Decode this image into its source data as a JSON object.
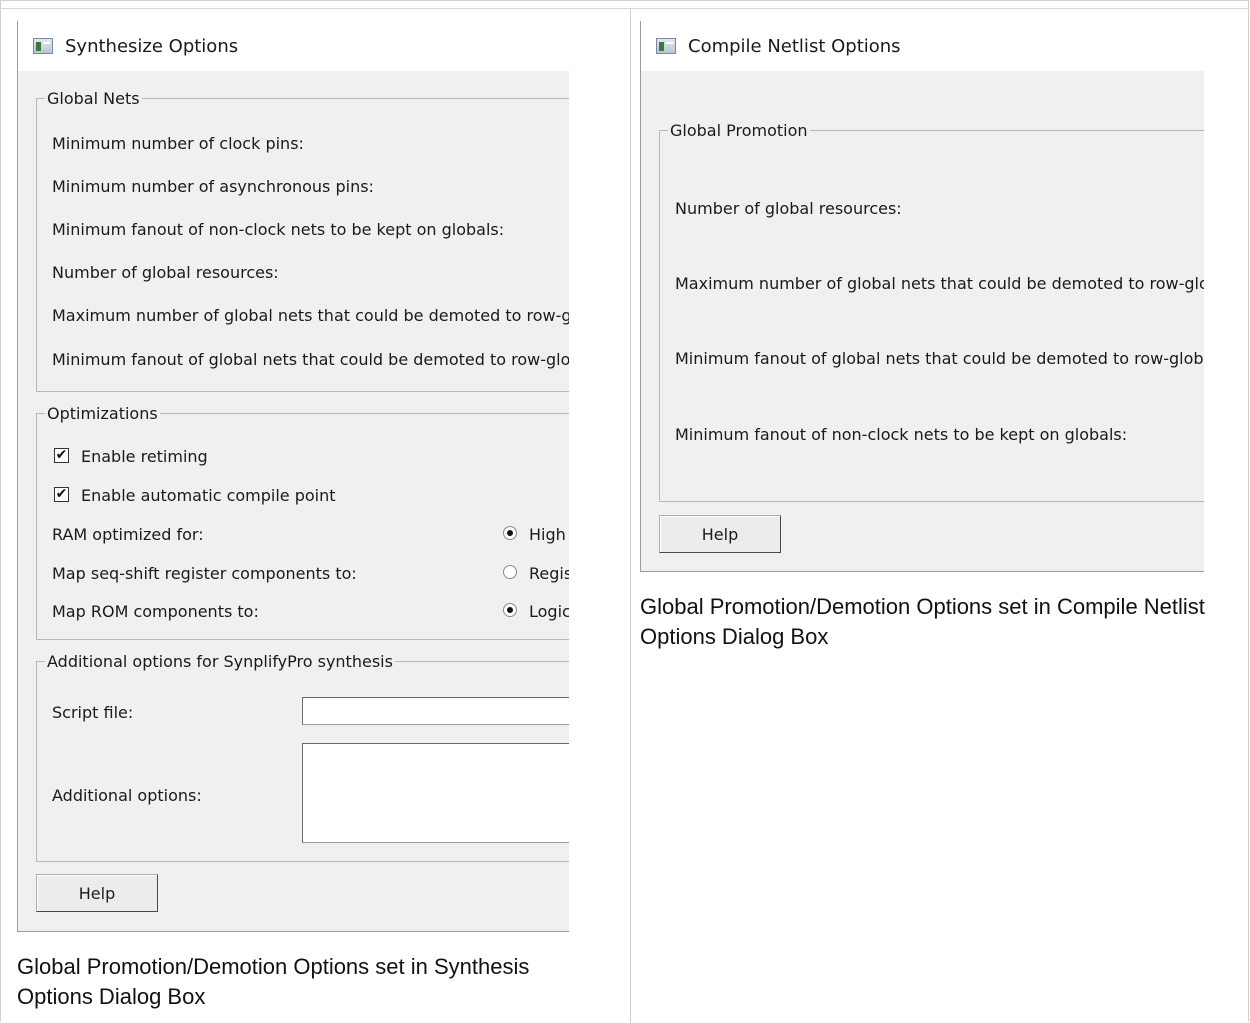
{
  "synth": {
    "title": "Synthesize Options",
    "global_nets": {
      "legend": "Global Nets",
      "rows": [
        "Minimum number of clock pins:",
        "Minimum number of asynchronous pins:",
        "Minimum fanout of non-clock nets to be kept on globals:",
        "Number of global resources:",
        "Maximum number of global nets that could be demoted to row-globals:",
        "Minimum fanout of global nets that could be demoted to row-globals:"
      ]
    },
    "optimizations": {
      "legend": "Optimizations",
      "enable_retiming": {
        "label": "Enable retiming",
        "checked": true
      },
      "enable_compile_point": {
        "label": "Enable automatic compile point",
        "checked": true
      },
      "ram": {
        "label": "RAM optimized for:",
        "option": "High",
        "selected": true
      },
      "seqshift": {
        "label": "Map seq-shift register components to:",
        "option": "Regis",
        "selected": false
      },
      "rom": {
        "label": "Map ROM components to:",
        "option": "Logic",
        "selected": true
      }
    },
    "additional": {
      "legend": "Additional options for SynplifyPro synthesis",
      "script_label": "Script file:",
      "script_value": "",
      "options_label": "Additional options:",
      "options_value": ""
    },
    "help_label": "Help",
    "caption": "Global Promotion/Demotion Options set in Synthesis Options Dialog Box"
  },
  "compile": {
    "title": "Compile Netlist Options",
    "global_promotion": {
      "legend": "Global Promotion",
      "rows": [
        "Number of global resources:",
        "Maximum number of global nets that could be demoted to row-globals:",
        "Minimum fanout of global nets that could be demoted to row-globals:",
        "Minimum fanout of non-clock nets to be kept on globals:"
      ]
    },
    "help_label": "Help",
    "caption": "Global Promotion/Demotion Options set in Compile Netlist Options Dialog Box"
  },
  "icons": {
    "window_icon": "app-window-icon",
    "check_mark": "✔"
  },
  "colors": {
    "dialog_bg": "#f0f0f0",
    "title_bg": "#ffffff",
    "border": "#b8b8b8"
  }
}
